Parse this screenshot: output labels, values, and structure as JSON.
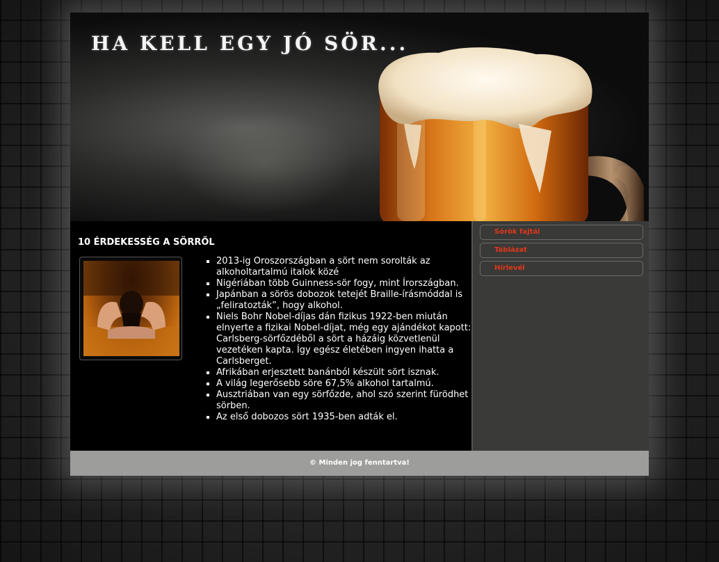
{
  "header": {
    "title": "HA KELL EGY JÓ SÖR..."
  },
  "article": {
    "heading": "10 ÉRDEKESSÉG A SÖRRŐL",
    "facts": [
      "2013-ig Oroszországban a sört nem sorolták az alkoholtartalmú italok közé",
      "Nigériában több Guinness-sör fogy, mint Írországban.",
      "Japánban a sörös dobozok tetejét Braille-írásmóddal is „feliratozták”, hogy alkohol.",
      "Niels Bohr Nobel-díjas dán fizikus 1922-ben miután elnyerte a fizikai Nobel-díjat, még egy ajándékot kapott: Carlsberg-sörfőzdéből a sört a házáig közvetlenül vezetéken kapta. Így egész életében ingyen ihatta a Carlsberget.",
      "Afrikában erjesztett banánból készült sört isznak.",
      "A világ legerősebb söre 67,5% alkohol tartalmú.",
      "Ausztriában van egy sörfőzde, ahol szó szerint fürödhet a sörben.",
      "Az első dobozos sört 1935-ben adták el."
    ]
  },
  "sidebar": {
    "menu": [
      {
        "label": "Sörök fajtái"
      },
      {
        "label": "Táblázat"
      },
      {
        "label": "Hírlevél"
      }
    ]
  },
  "footer": {
    "copyright": "© Minden jog fenntartva!"
  },
  "colors": {
    "menu_text": "#e2381a",
    "footer_bg": "#9d9d9b",
    "sidebar_bg": "#3a3a38"
  }
}
